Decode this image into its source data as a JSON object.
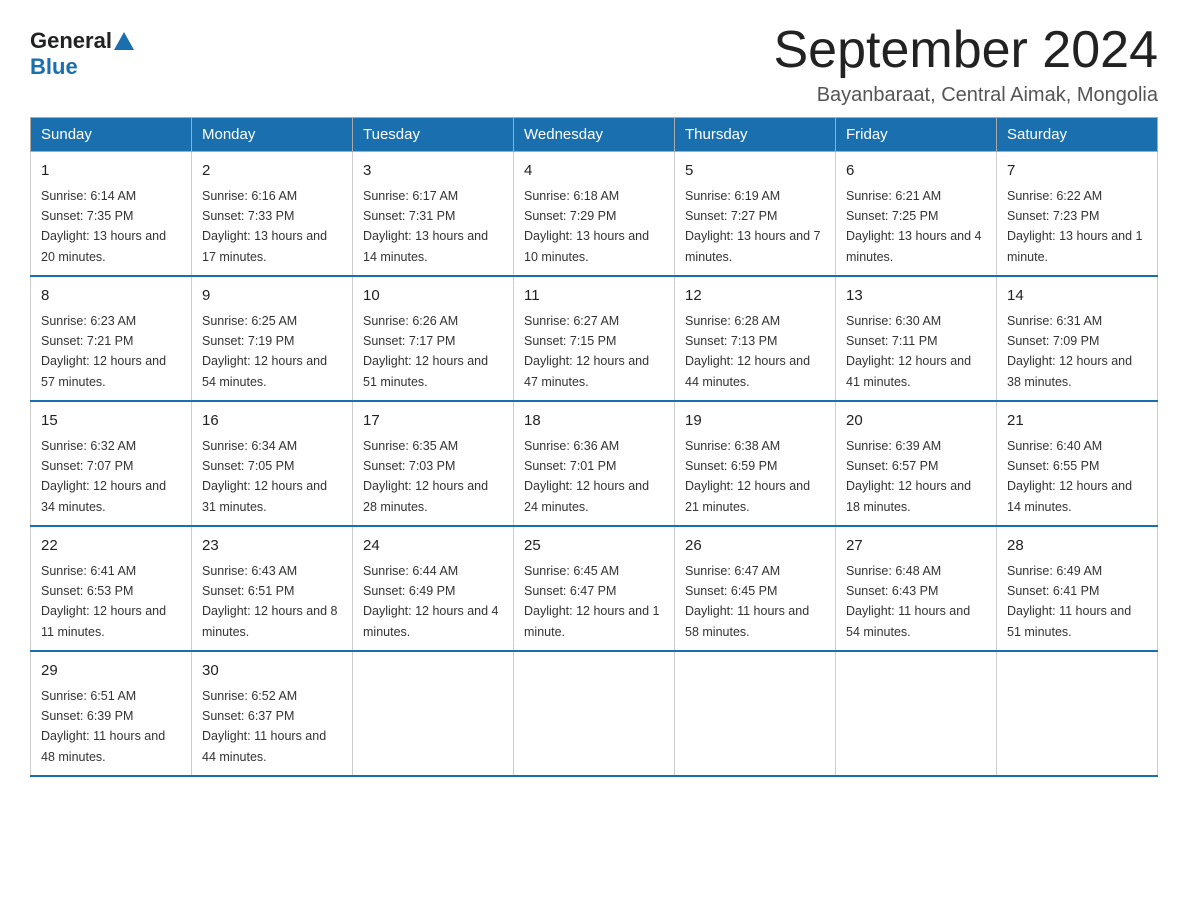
{
  "header": {
    "logo_general": "General",
    "logo_blue": "Blue",
    "month_title": "September 2024",
    "location": "Bayanbaraat, Central Aimak, Mongolia"
  },
  "weekdays": [
    "Sunday",
    "Monday",
    "Tuesday",
    "Wednesday",
    "Thursday",
    "Friday",
    "Saturday"
  ],
  "weeks": [
    [
      {
        "day": "1",
        "sunrise": "6:14 AM",
        "sunset": "7:35 PM",
        "daylight": "13 hours and 20 minutes."
      },
      {
        "day": "2",
        "sunrise": "6:16 AM",
        "sunset": "7:33 PM",
        "daylight": "13 hours and 17 minutes."
      },
      {
        "day": "3",
        "sunrise": "6:17 AM",
        "sunset": "7:31 PM",
        "daylight": "13 hours and 14 minutes."
      },
      {
        "day": "4",
        "sunrise": "6:18 AM",
        "sunset": "7:29 PM",
        "daylight": "13 hours and 10 minutes."
      },
      {
        "day": "5",
        "sunrise": "6:19 AM",
        "sunset": "7:27 PM",
        "daylight": "13 hours and 7 minutes."
      },
      {
        "day": "6",
        "sunrise": "6:21 AM",
        "sunset": "7:25 PM",
        "daylight": "13 hours and 4 minutes."
      },
      {
        "day": "7",
        "sunrise": "6:22 AM",
        "sunset": "7:23 PM",
        "daylight": "13 hours and 1 minute."
      }
    ],
    [
      {
        "day": "8",
        "sunrise": "6:23 AM",
        "sunset": "7:21 PM",
        "daylight": "12 hours and 57 minutes."
      },
      {
        "day": "9",
        "sunrise": "6:25 AM",
        "sunset": "7:19 PM",
        "daylight": "12 hours and 54 minutes."
      },
      {
        "day": "10",
        "sunrise": "6:26 AM",
        "sunset": "7:17 PM",
        "daylight": "12 hours and 51 minutes."
      },
      {
        "day": "11",
        "sunrise": "6:27 AM",
        "sunset": "7:15 PM",
        "daylight": "12 hours and 47 minutes."
      },
      {
        "day": "12",
        "sunrise": "6:28 AM",
        "sunset": "7:13 PM",
        "daylight": "12 hours and 44 minutes."
      },
      {
        "day": "13",
        "sunrise": "6:30 AM",
        "sunset": "7:11 PM",
        "daylight": "12 hours and 41 minutes."
      },
      {
        "day": "14",
        "sunrise": "6:31 AM",
        "sunset": "7:09 PM",
        "daylight": "12 hours and 38 minutes."
      }
    ],
    [
      {
        "day": "15",
        "sunrise": "6:32 AM",
        "sunset": "7:07 PM",
        "daylight": "12 hours and 34 minutes."
      },
      {
        "day": "16",
        "sunrise": "6:34 AM",
        "sunset": "7:05 PM",
        "daylight": "12 hours and 31 minutes."
      },
      {
        "day": "17",
        "sunrise": "6:35 AM",
        "sunset": "7:03 PM",
        "daylight": "12 hours and 28 minutes."
      },
      {
        "day": "18",
        "sunrise": "6:36 AM",
        "sunset": "7:01 PM",
        "daylight": "12 hours and 24 minutes."
      },
      {
        "day": "19",
        "sunrise": "6:38 AM",
        "sunset": "6:59 PM",
        "daylight": "12 hours and 21 minutes."
      },
      {
        "day": "20",
        "sunrise": "6:39 AM",
        "sunset": "6:57 PM",
        "daylight": "12 hours and 18 minutes."
      },
      {
        "day": "21",
        "sunrise": "6:40 AM",
        "sunset": "6:55 PM",
        "daylight": "12 hours and 14 minutes."
      }
    ],
    [
      {
        "day": "22",
        "sunrise": "6:41 AM",
        "sunset": "6:53 PM",
        "daylight": "12 hours and 11 minutes."
      },
      {
        "day": "23",
        "sunrise": "6:43 AM",
        "sunset": "6:51 PM",
        "daylight": "12 hours and 8 minutes."
      },
      {
        "day": "24",
        "sunrise": "6:44 AM",
        "sunset": "6:49 PM",
        "daylight": "12 hours and 4 minutes."
      },
      {
        "day": "25",
        "sunrise": "6:45 AM",
        "sunset": "6:47 PM",
        "daylight": "12 hours and 1 minute."
      },
      {
        "day": "26",
        "sunrise": "6:47 AM",
        "sunset": "6:45 PM",
        "daylight": "11 hours and 58 minutes."
      },
      {
        "day": "27",
        "sunrise": "6:48 AM",
        "sunset": "6:43 PM",
        "daylight": "11 hours and 54 minutes."
      },
      {
        "day": "28",
        "sunrise": "6:49 AM",
        "sunset": "6:41 PM",
        "daylight": "11 hours and 51 minutes."
      }
    ],
    [
      {
        "day": "29",
        "sunrise": "6:51 AM",
        "sunset": "6:39 PM",
        "daylight": "11 hours and 48 minutes."
      },
      {
        "day": "30",
        "sunrise": "6:52 AM",
        "sunset": "6:37 PM",
        "daylight": "11 hours and 44 minutes."
      },
      null,
      null,
      null,
      null,
      null
    ]
  ]
}
